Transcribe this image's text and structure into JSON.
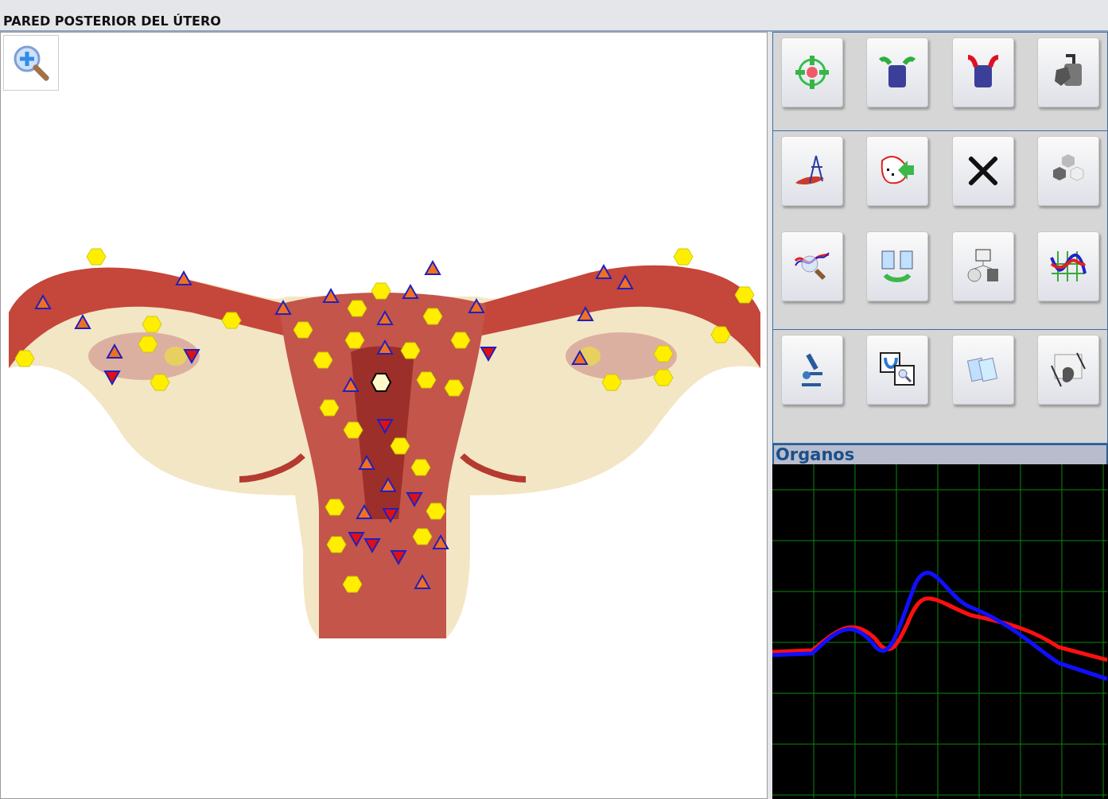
{
  "window": {
    "title": "PARED POSTERIOR DEL ÚTERO"
  },
  "graph_panel": {
    "title": "Organos"
  }
}
